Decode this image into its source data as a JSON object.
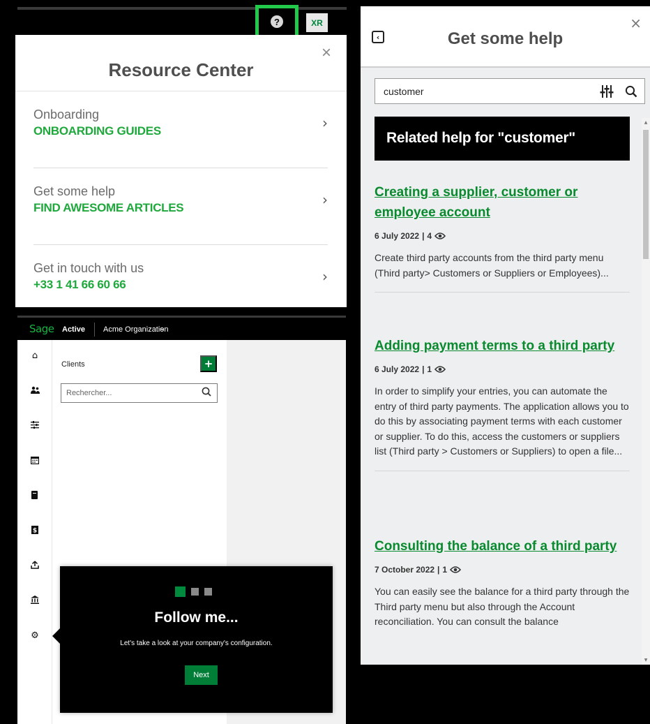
{
  "topbar": {
    "help_icon": "question-circle-icon",
    "avatar_initials": "XR"
  },
  "resource_center": {
    "title": "Resource Center",
    "close_label": "×",
    "items": [
      {
        "title": "Onboarding",
        "subtitle": "ONBOARDING GUIDES"
      },
      {
        "title": "Get some help",
        "subtitle": "FIND AWESOME ARTICLES"
      },
      {
        "title": "Get in touch with us",
        "subtitle": "+33 1 41 66 60 66"
      }
    ]
  },
  "sage": {
    "logo": "Sage",
    "product": "Active",
    "organization": "Acme Organization",
    "list_title": "Clients",
    "add_label": "+",
    "search_placeholder": "Rechercher...",
    "nav_icons": [
      "home-icon",
      "users-icon",
      "sliders-icon",
      "calendar-icon",
      "book-icon",
      "dollar-icon",
      "upload-icon",
      "bank-icon",
      "gear-icon"
    ]
  },
  "tour": {
    "title": "Follow me...",
    "text": "Let's take a look at your company's configuration.",
    "next_label": "Next",
    "steps_total": 3,
    "step_current": 1
  },
  "help_panel": {
    "title": "Get some help",
    "search_value": "customer",
    "banner": "Related help for \"customer\"",
    "articles": [
      {
        "title": "Creating a supplier, customer or employee account",
        "date": "6 July 2022",
        "views": "4",
        "excerpt": "Create third party accounts from the third party menu (Third party> Customers or Suppliers or Employees)..."
      },
      {
        "title": "Adding payment terms to a third party",
        "date": "6 July 2022",
        "views": "1",
        "excerpt": "In order to simplify your entries, you can automate the entry of third party payments. The application allows you to do this by associating payment terms with each customer or supplier. To do this, access the customers or suppliers list (Third party > Customers or Suppliers) to open a file..."
      },
      {
        "title": "Consulting the balance of a third party",
        "date": "7 October 2022",
        "views": "1",
        "excerpt": "You can easily see the balance for a third party through the Third party menu but also through the Account reconciliation. You can consult the balance"
      }
    ]
  },
  "colors": {
    "accent_green": "#1fa83c",
    "link_green": "#0a8a2f",
    "button_green": "#007e38",
    "highlight_border": "#23c94a"
  }
}
